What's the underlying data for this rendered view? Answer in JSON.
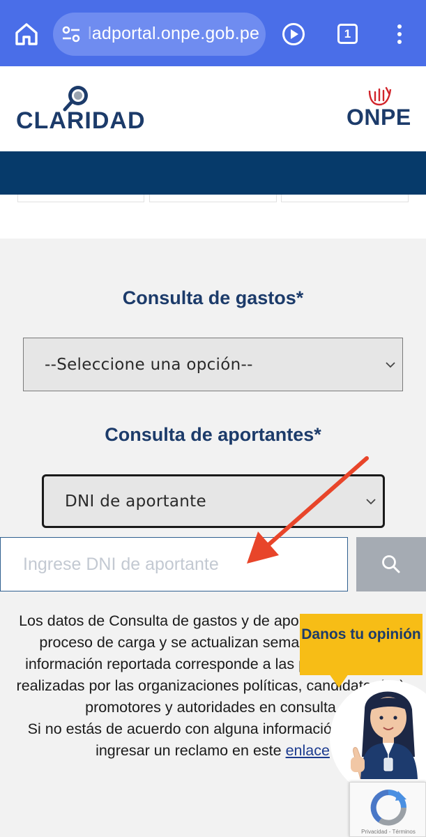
{
  "browser": {
    "url_faded": "l",
    "url": "adportal.onpe.gob.pe",
    "tab_count": "1",
    "icons": [
      "home-icon",
      "site-settings-icon",
      "play-icon",
      "tab-switcher-icon",
      "more-menu-icon"
    ],
    "theme_color": "#4a6ee8"
  },
  "header": {
    "logo_text": "CLARIDAD",
    "onpe_text": "ONPE",
    "brand_color": "#1c3b6a",
    "nav_color": "#063a6a"
  },
  "form": {
    "gastos_title": "Consulta de gastos*",
    "gastos_selected": "--Seleccione una opción--",
    "aportantes_title": "Consulta de aportantes*",
    "aportantes_selected": "DNI de aportante",
    "dni_placeholder": "Ingrese DNI de aportante",
    "dni_value": ""
  },
  "info": {
    "text": "Los datos de Consulta de gastos y de aportantes están en proceso de carga y se actualizan semanalmente. La información reportada corresponde a las presentaciones realizadas por las organizaciones políticas, candidatos(as), promotores y autoridades en consulta.",
    "text2": "Si no estás de acuerdo con alguna información, puedes ingresar un reclamo en este ",
    "link": "enlace"
  },
  "feedback": {
    "text": "Danos tu opinión",
    "bubble_color": "#f7bd16"
  },
  "recaptcha": {
    "terms": "Privacidad - Términos"
  }
}
